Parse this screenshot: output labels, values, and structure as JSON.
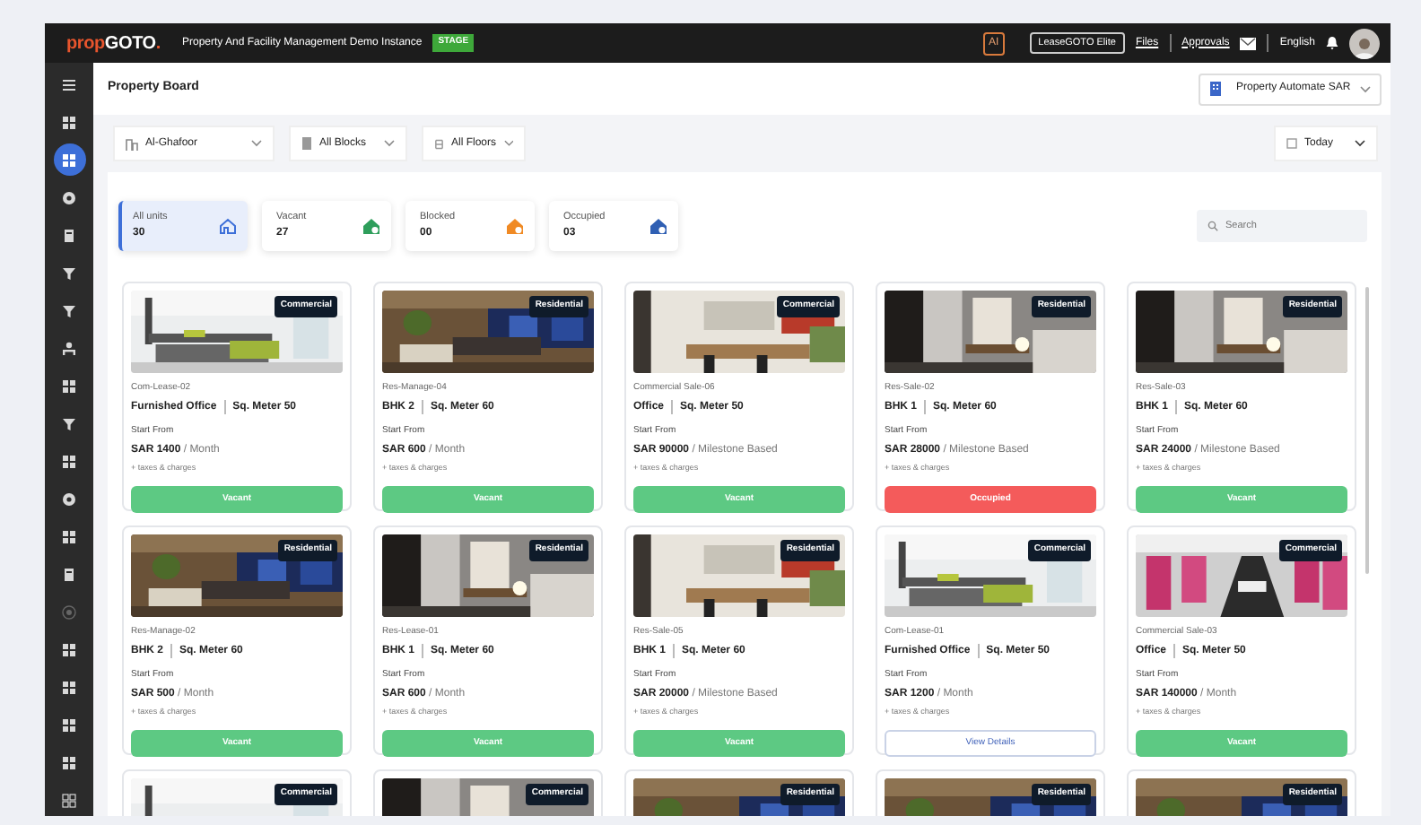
{
  "topbar": {
    "logo": [
      {
        "text": "prop",
        "color": "#e8552d"
      },
      {
        "text": "GOTO",
        "color": "#ffffff"
      },
      {
        "text": ".",
        "color": "#e8552d"
      }
    ],
    "instance_title": "Property And Facility Management Demo Instance",
    "env_badge": "STAGE",
    "ai_label": "AI",
    "plan_button": "LeaseGOTO Elite",
    "links": [
      "Files",
      "Approvals"
    ],
    "language": "English"
  },
  "sidebar": {
    "items": [
      {
        "kind": "menu",
        "selected": false
      },
      {
        "kind": "grid",
        "selected": false
      },
      {
        "kind": "grid",
        "selected": true
      },
      {
        "kind": "globe",
        "selected": false
      },
      {
        "kind": "doc",
        "selected": false
      },
      {
        "kind": "filter",
        "selected": false
      },
      {
        "kind": "filter",
        "selected": false
      },
      {
        "kind": "org",
        "selected": false
      },
      {
        "kind": "grid",
        "selected": false
      },
      {
        "kind": "filter",
        "selected": false
      },
      {
        "kind": "grid",
        "selected": false
      },
      {
        "kind": "globe",
        "selected": false
      },
      {
        "kind": "grid",
        "selected": false
      },
      {
        "kind": "doc",
        "selected": false
      },
      {
        "kind": "target",
        "selected": false
      },
      {
        "kind": "grid",
        "selected": false
      },
      {
        "kind": "grid",
        "selected": false
      },
      {
        "kind": "grid",
        "selected": false
      },
      {
        "kind": "grid",
        "selected": false
      },
      {
        "kind": "outline",
        "selected": false
      }
    ]
  },
  "page_title": "Property Board",
  "property_select": "Property Automate SAR",
  "filters": [
    {
      "label": "Al-Ghafoor",
      "kind": "building"
    },
    {
      "label": "All Blocks",
      "kind": "block"
    },
    {
      "label": "All Floors",
      "kind": "floor"
    }
  ],
  "date_filter": "Today",
  "stats": [
    {
      "label": "All units",
      "count": "30",
      "selected": true,
      "color": "#3d6fd8"
    },
    {
      "label": "Vacant",
      "count": "27",
      "selected": false,
      "color": "#2e9e5b"
    },
    {
      "label": "Blocked",
      "count": "00",
      "selected": false,
      "color": "#f08a24"
    },
    {
      "label": "Occupied",
      "count": "03",
      "selected": false,
      "color": "#2f5fb3"
    }
  ],
  "search": {
    "placeholder": "Search"
  },
  "units": [
    {
      "badge": "Commercial",
      "code": "Com-Lease-02",
      "type": "Furnished Office",
      "area": "Sq. Meter 50",
      "start": "Start From",
      "price": "SAR 1400",
      "period": "/ Month",
      "note": "+ taxes & charges",
      "status": {
        "kind": "vacant",
        "label": "Vacant"
      }
    },
    {
      "badge": "Residential",
      "code": "Res-Manage-04",
      "type": "BHK 2",
      "area": "Sq. Meter 60",
      "start": "Start From",
      "price": "SAR 600",
      "period": "/ Month",
      "note": "+ taxes & charges",
      "status": {
        "kind": "vacant",
        "label": "Vacant"
      }
    },
    {
      "badge": "Commercial",
      "code": "Commercial Sale-06",
      "type": "Office",
      "area": "Sq. Meter 50",
      "start": "Start From",
      "price": "SAR 90000",
      "period": "/ Milestone Based",
      "note": "+ taxes & charges",
      "status": {
        "kind": "vacant",
        "label": "Vacant"
      }
    },
    {
      "badge": "Residential",
      "code": "Res-Sale-02",
      "type": "BHK 1",
      "area": "Sq. Meter 60",
      "start": "Start From",
      "price": "SAR 28000",
      "period": "/ Milestone Based",
      "note": "+ taxes & charges",
      "status": {
        "kind": "occupied",
        "label": "Occupied"
      }
    },
    {
      "badge": "Residential",
      "code": "Res-Sale-03",
      "type": "BHK 1",
      "area": "Sq. Meter 60",
      "start": "Start From",
      "price": "SAR 24000",
      "period": "/ Milestone Based",
      "note": "+ taxes & charges",
      "status": {
        "kind": "vacant",
        "label": "Vacant"
      }
    },
    {
      "badge": "Residential",
      "code": "Res-Manage-02",
      "type": "BHK 2",
      "area": "Sq. Meter 60",
      "start": "Start From",
      "price": "SAR 500",
      "period": "/ Month",
      "note": "+ taxes & charges",
      "status": {
        "kind": "vacant",
        "label": "Vacant"
      }
    },
    {
      "badge": "Residential",
      "code": "Res-Lease-01",
      "type": "BHK 1",
      "area": "Sq. Meter 60",
      "start": "Start From",
      "price": "SAR 600",
      "period": "/ Month",
      "note": "+ taxes & charges",
      "status": {
        "kind": "vacant",
        "label": "Vacant"
      }
    },
    {
      "badge": "Residential",
      "code": "Res-Sale-05",
      "type": "BHK 1",
      "area": "Sq. Meter 60",
      "start": "Start From",
      "price": "SAR 20000",
      "period": "/ Milestone Based",
      "note": "+ taxes & charges",
      "status": {
        "kind": "vacant",
        "label": "Vacant"
      }
    },
    {
      "badge": "Commercial",
      "code": "Com-Lease-01",
      "type": "Furnished Office",
      "area": "Sq. Meter 50",
      "start": "Start From",
      "price": "SAR 1200",
      "period": "/ Month",
      "note": "+ taxes & charges",
      "status": {
        "kind": "details",
        "label": "View Details"
      }
    },
    {
      "badge": "Commercial",
      "code": "Commercial Sale-03",
      "type": "Office",
      "area": "Sq. Meter 50",
      "start": "Start From",
      "price": "SAR 140000",
      "period": "/ Month",
      "note": "+ taxes & charges",
      "status": {
        "kind": "vacant",
        "label": "Vacant"
      }
    },
    {
      "badge": "Commercial"
    },
    {
      "badge": "Commercial"
    },
    {
      "badge": "Residential"
    },
    {
      "badge": "Residential"
    },
    {
      "badge": "Residential"
    }
  ]
}
